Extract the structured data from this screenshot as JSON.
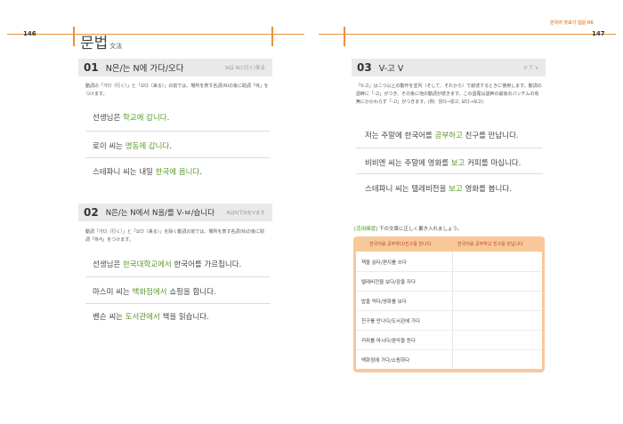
{
  "running_header": {
    "text": "한국어 맛보기 입문",
    "page_tag": "06"
  },
  "left_page": {
    "page_number": "146",
    "title": "문법",
    "title_sub": "文法",
    "section1": {
      "num": "01",
      "title": "N은/는 N에 가다/오다",
      "tag": "Nは Nに行く/来る",
      "desc": "動詞の「가다（行く）」と「오다（来る）」の前では、場所を表す名詞(N)の後に助詞「에」をつけます。",
      "examples": [
        {
          "a": "선생님은 ",
          "b": "학교에 갑니다",
          "c": "."
        },
        {
          "a": "로이 씨는 ",
          "b": "명동에 갑니다",
          "c": "."
        },
        {
          "a": "스테파니 씨는 내일 ",
          "b": "한국에 옵니다",
          "c": "."
        }
      ]
    },
    "section2": {
      "num": "02",
      "title": "N은/는 N에서 N을/를 V-ㅂ/습니다",
      "tag": "NはNでNをVます",
      "desc": "動詞「가다（行く）」と「오다（来る）」を除く動詞の前では、場所を表す名詞(N)の後に助詞「에서」をつけます。",
      "examples": [
        {
          "a": "선생님은 ",
          "b": "한국대학교에서",
          "c": " 한국어를 가르칩니다."
        },
        {
          "a": "마스미 씨는 ",
          "b": "백화점에서",
          "c": " 쇼핑을 합니다."
        },
        {
          "a": "벤슨 씨는 ",
          "b": "도서관에서",
          "c": " 책을 읽습니다."
        }
      ]
    }
  },
  "right_page": {
    "page_number": "147",
    "section3": {
      "num": "03",
      "title": "V-고 V",
      "tag": "V て V",
      "desc": "「V-고」は二つ以上の動作を並列（そして、それから）で叙述するときに使用します。動詞の語幹に「-고」がつき、その後に他の動詞が続きます。この語尾は語幹の最後のパッチムの有無にかかわらず「-고」がつきます。(例：읽다→읽고, 보다→보고)",
      "examples": [
        {
          "a": "저는 주말에 한국어를 ",
          "b": "공부하고",
          "c": " 친구를 만납니다."
        },
        {
          "a": "비비엔 씨는 주말에 영화를 ",
          "b": "보고",
          "c": " 커피를 마십니다."
        },
        {
          "a": "스테파니 씨는 텔레비전을 ",
          "b": "보고",
          "c": " 영화를 봅니다."
        }
      ]
    },
    "practice": {
      "label_tag": "[活用練習]",
      "label_text": " 下の文章に正しく書き入れましょう。",
      "header_left": "한국어를 공부하다/친구를 만나다",
      "header_right": "한국어를 공부하고 친구를 만납니다",
      "rows": [
        "책을 읽다/편지를 쓰다",
        "텔레비전을 보다/잠을 자다",
        "밥을 먹다/영화를 보다",
        "친구를 만나다/도서관에 가다",
        "커피를 마시다/음악을 듣다",
        "백화점에 가다/쇼핑하다"
      ]
    }
  }
}
